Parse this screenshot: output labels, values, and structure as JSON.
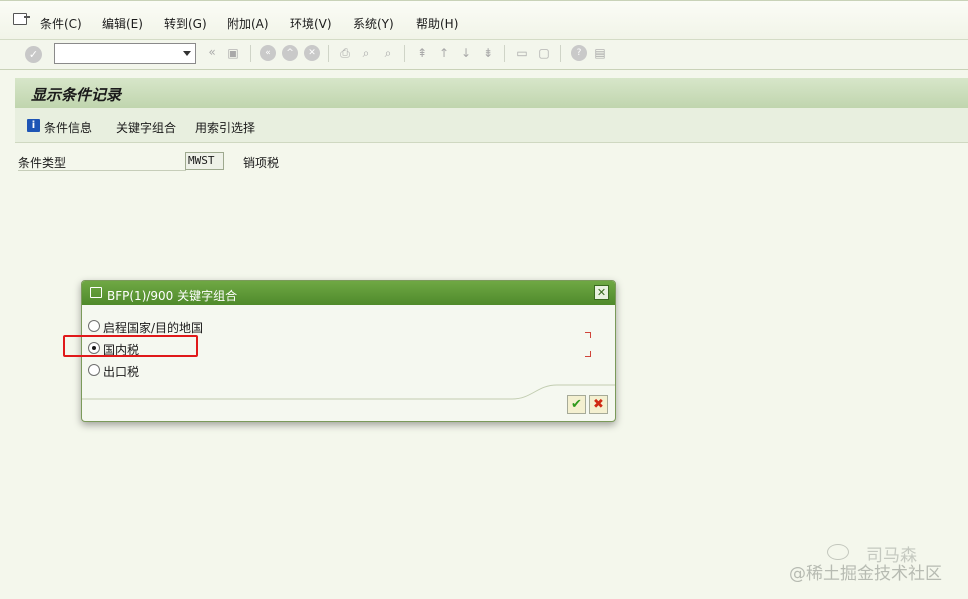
{
  "menubar": {
    "items": [
      "条件(C)",
      "编辑(E)",
      "转到(G)",
      "附加(A)",
      "环境(V)",
      "系统(Y)",
      "帮助(H)"
    ]
  },
  "toolbar": {
    "command_field_value": ""
  },
  "page": {
    "title": "显示条件记录"
  },
  "app_toolbar": {
    "items": [
      "条件信息",
      "关键字组合",
      "用索引选择"
    ]
  },
  "fields": {
    "condition_type_label": "条件类型",
    "condition_type_value": "MWST",
    "condition_type_desc": "销项税"
  },
  "dialog": {
    "title": "BFP(1)/900 关键字组合",
    "options": [
      {
        "label": "启程国家/目的地国",
        "checked": false
      },
      {
        "label": "国内税",
        "checked": true
      },
      {
        "label": "出口税",
        "checked": false
      }
    ]
  },
  "watermark": {
    "name": "司马森",
    "text": "@稀土掘金技术社区"
  },
  "colors": {
    "accent_green": "#4f8a2b",
    "highlight_red": "#e0191a"
  }
}
